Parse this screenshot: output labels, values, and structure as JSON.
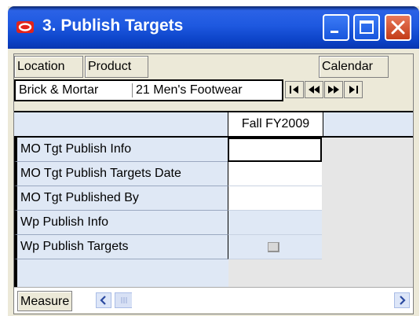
{
  "window": {
    "title": "3. Publish Targets",
    "accent_color": "#0c43c8",
    "close_color": "#c33c18"
  },
  "dimension_buttons": {
    "location": "Location",
    "product": "Product",
    "calendar": "Calendar"
  },
  "context": {
    "location_value": "Brick & Mortar",
    "product_value": "21 Men's Footwear",
    "nav_icons": [
      "first-page-icon",
      "previous-page-icon",
      "next-page-icon",
      "last-page-icon"
    ]
  },
  "grid": {
    "column_header": "Fall FY2009",
    "rows": [
      {
        "label": "MO Tgt Publish Info",
        "cell": "white"
      },
      {
        "label": "MO Tgt Publish Targets Date",
        "cell": "white"
      },
      {
        "label": "MO Tgt Published By",
        "cell": "white"
      },
      {
        "label": "Wp Publish Info",
        "cell": "blue"
      },
      {
        "label": "Wp Publish Targets",
        "cell": "checkbox"
      }
    ]
  },
  "bottom": {
    "measure_button": "Measure"
  }
}
